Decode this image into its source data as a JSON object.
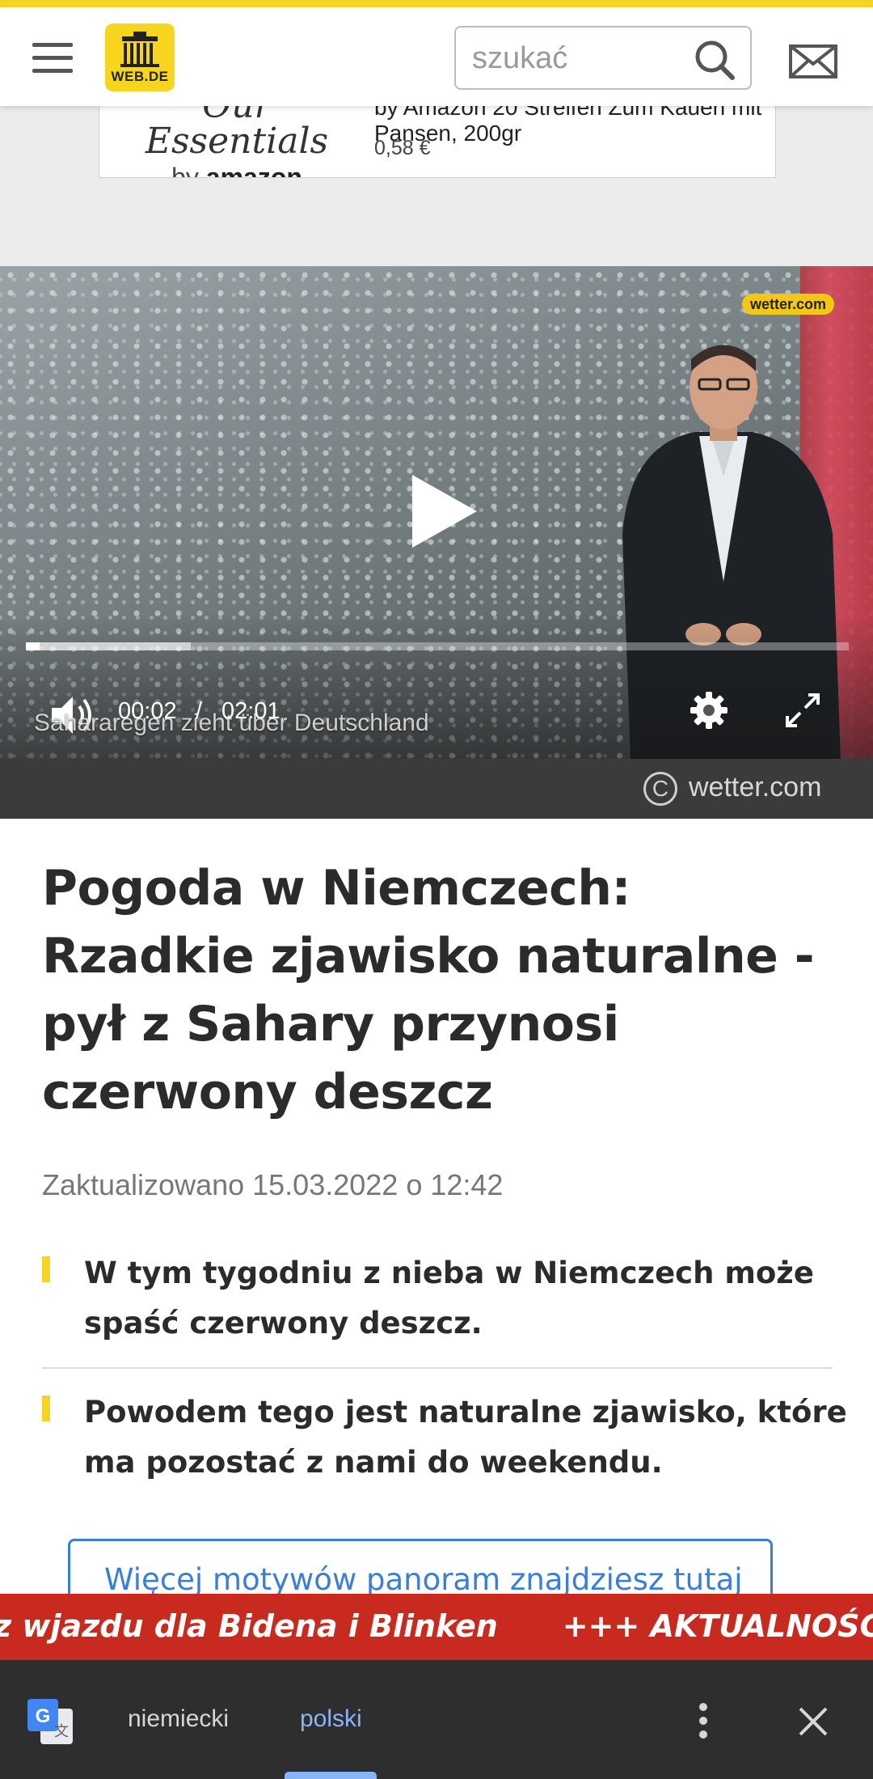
{
  "colors": {
    "brand_yellow": "#f5d523",
    "link_blue": "#3a7fd5",
    "ticker_red": "#c92a1f",
    "translate_bar": "#2e2e2e",
    "translate_active": "#8ab4f8"
  },
  "header": {
    "logo_text": "WEB.DE",
    "search_placeholder": "szukać",
    "icons": [
      "menu-icon",
      "search-icon",
      "mail-icon"
    ]
  },
  "ad": {
    "brand_script": "Our Essentials",
    "brand_by": "by",
    "brand_name": "amazon",
    "product": "by Amazon 20 Streifen Zum Kauen mit Pansen, 200gr",
    "price": "0,58 €"
  },
  "video": {
    "watermark": "wetter.com",
    "time_current": "00:02",
    "time_separator": "/",
    "time_total": "02:01",
    "caption": "Sahararegen zieht über Deutschland",
    "progress_fraction": 0.017,
    "buffered_fraction": 0.2,
    "credit": "wetter.com",
    "icons": [
      "play-icon",
      "volume-icon",
      "settings-icon",
      "fullscreen-icon",
      "copyright-icon"
    ]
  },
  "article": {
    "headline": "Pogoda w Niemczech: Rzadkie zjawisko naturalne - pył z Sahary przynosi czerwony deszcz",
    "updated": "Zaktualizowano 15.03.2022 o 12:42",
    "bullets": [
      "W tym tygodniu z nieba w Niemczech może spaść czerwony deszcz.",
      "Powodem tego jest naturalne zjawisko, które ma pozostać z nami do weekendu."
    ],
    "more_link": "Więcej motywów panoram znajdziesz tutaj"
  },
  "ticker": {
    "item_1": "z wjazdu dla Bidena i Blinken",
    "item_2": "+++ AKTUALNOŚCI +++ Ro"
  },
  "translate_bar": {
    "source_language": "niemiecki",
    "target_language": "polski",
    "icons": [
      "google-translate-icon",
      "more-vert-icon",
      "close-icon"
    ]
  }
}
